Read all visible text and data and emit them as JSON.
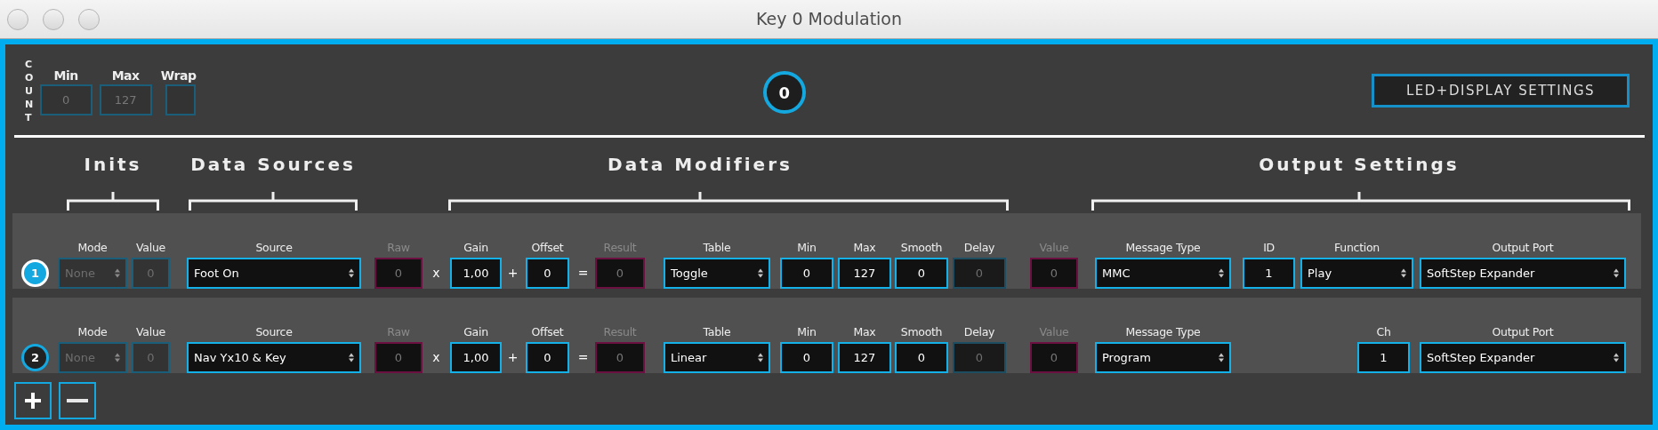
{
  "window": {
    "title": "Key 0 Modulation"
  },
  "count": {
    "label": "COUNT",
    "min": {
      "label": "Min",
      "value": "0",
      "disabled": true
    },
    "max": {
      "label": "Max",
      "value": "127",
      "disabled": true
    },
    "wrap": {
      "label": "Wrap",
      "checked": false,
      "disabled": true
    }
  },
  "counter_display": {
    "value": "0"
  },
  "led_button": {
    "label": "LED+DISPLAY SETTINGS"
  },
  "sections": [
    {
      "label": "Inits"
    },
    {
      "label": "Data Sources"
    },
    {
      "label": "Data Modifiers"
    },
    {
      "label": "Output Settings"
    }
  ],
  "rows": [
    {
      "number": "1",
      "selected": true,
      "cells": [
        {
          "kind": "mode",
          "label": "Mode",
          "value": "None",
          "disabled": true
        },
        {
          "kind": "init_value",
          "label": "Value",
          "value": "0",
          "disabled": true
        },
        {
          "kind": "source",
          "label": "Source",
          "value": "Foot On",
          "disabled": false
        },
        {
          "kind": "raw",
          "label": "Raw",
          "value": "0",
          "disabled": false
        },
        {
          "kind": "times",
          "value": "x"
        },
        {
          "kind": "gain",
          "label": "Gain",
          "value": "1,00",
          "disabled": false
        },
        {
          "kind": "plus",
          "value": "+"
        },
        {
          "kind": "offset",
          "label": "Offset",
          "value": "0",
          "disabled": false
        },
        {
          "kind": "equals",
          "value": "="
        },
        {
          "kind": "result",
          "label": "Result",
          "value": "0",
          "disabled": false
        },
        {
          "kind": "table",
          "label": "Table",
          "value": "Toggle",
          "disabled": false
        },
        {
          "kind": "min",
          "label": "Min",
          "value": "0",
          "disabled": false
        },
        {
          "kind": "max",
          "label": "Max",
          "value": "127",
          "disabled": false
        },
        {
          "kind": "smooth",
          "label": "Smooth",
          "value": "0",
          "disabled": false
        },
        {
          "kind": "delay",
          "label": "Delay",
          "value": "0",
          "disabled": true
        },
        {
          "kind": "value",
          "label": "Value",
          "value": "0",
          "disabled": false
        },
        {
          "kind": "message_type",
          "label": "Message Type",
          "value": "MMC",
          "disabled": false
        },
        {
          "kind": "id",
          "label": "ID",
          "value": "1",
          "disabled": false
        },
        {
          "kind": "function",
          "label": "Function",
          "value": "Play",
          "disabled": false
        },
        {
          "kind": "output_port",
          "label": "Output Port",
          "value": "SoftStep Expander",
          "disabled": false
        }
      ]
    },
    {
      "number": "2",
      "selected": false,
      "cells": [
        {
          "kind": "mode",
          "label": "Mode",
          "value": "None",
          "disabled": true
        },
        {
          "kind": "init_value",
          "label": "Value",
          "value": "0",
          "disabled": true
        },
        {
          "kind": "source",
          "label": "Source",
          "value": "Nav Yx10 & Key",
          "disabled": false
        },
        {
          "kind": "raw",
          "label": "Raw",
          "value": "0",
          "disabled": false
        },
        {
          "kind": "times",
          "value": "x"
        },
        {
          "kind": "gain",
          "label": "Gain",
          "value": "1,00",
          "disabled": false
        },
        {
          "kind": "plus",
          "value": "+"
        },
        {
          "kind": "offset",
          "label": "Offset",
          "value": "0",
          "disabled": false
        },
        {
          "kind": "equals",
          "value": "="
        },
        {
          "kind": "result",
          "label": "Result",
          "value": "0",
          "disabled": false
        },
        {
          "kind": "table",
          "label": "Table",
          "value": "Linear",
          "disabled": false
        },
        {
          "kind": "min",
          "label": "Min",
          "value": "0",
          "disabled": false
        },
        {
          "kind": "max",
          "label": "Max",
          "value": "127",
          "disabled": false
        },
        {
          "kind": "smooth",
          "label": "Smooth",
          "value": "0",
          "disabled": false
        },
        {
          "kind": "delay",
          "label": "Delay",
          "value": "0",
          "disabled": true
        },
        {
          "kind": "value",
          "label": "Value",
          "value": "0",
          "disabled": false
        },
        {
          "kind": "message_type",
          "label": "Message Type",
          "value": "Program",
          "disabled": false
        },
        {
          "kind": "ch",
          "label": "Ch",
          "value": "1",
          "disabled": false
        },
        {
          "kind": "output_port",
          "label": "Output Port",
          "value": "SoftStep Expander",
          "disabled": false
        }
      ]
    }
  ]
}
